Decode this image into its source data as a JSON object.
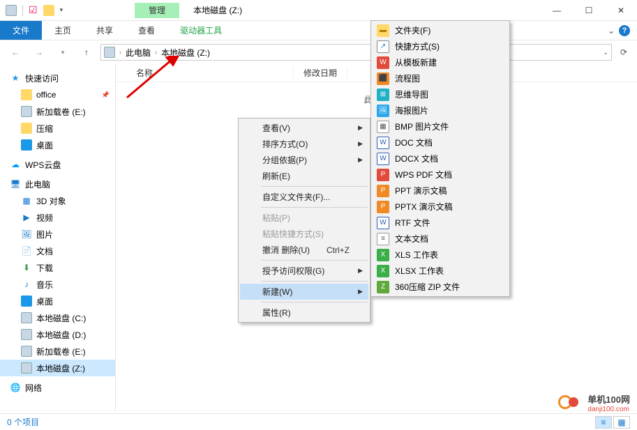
{
  "title": "本地磁盘 (Z:)",
  "ribbon_ctx_group": "管理",
  "tabs": {
    "file": "文件",
    "home": "主页",
    "share": "共享",
    "view": "查看",
    "drive_tools": "驱动器工具"
  },
  "breadcrumb": {
    "root": "此电脑",
    "current": "本地磁盘 (Z:)"
  },
  "columns": {
    "name": "名称",
    "date": "修改日期"
  },
  "empty_folder_msg": "此文件",
  "nav": {
    "quick_access": "快速访问",
    "office": "office",
    "new_volume_e": "新加载卷 (E:)",
    "compressed": "压缩",
    "desktop": "桌面",
    "wps": "WPS云盘",
    "this_pc": "此电脑",
    "objects_3d": "3D 对象",
    "videos": "视频",
    "pictures": "图片",
    "documents": "文档",
    "downloads": "下载",
    "music": "音乐",
    "desktop2": "桌面",
    "drive_c": "本地磁盘 (C:)",
    "drive_d": "本地磁盘 (D:)",
    "new_volume_e2": "新加载卷 (E:)",
    "drive_z": "本地磁盘 (Z:)",
    "network": "网络"
  },
  "ctx": {
    "view": "查看(V)",
    "sort": "排序方式(O)",
    "group": "分组依据(P)",
    "refresh": "刷新(E)",
    "custom_folder": "自定义文件夹(F)...",
    "paste": "粘贴(P)",
    "paste_shortcut": "粘贴快捷方式(S)",
    "undo": "撤消 删除(U)",
    "undo_sc": "Ctrl+Z",
    "grant_access": "授予访问权限(G)",
    "new": "新建(W)",
    "properties": "属性(R)"
  },
  "submenu": {
    "folder": "文件夹(F)",
    "shortcut": "快捷方式(S)",
    "from_template": "从模板新建",
    "flowchart": "流程图",
    "mindmap": "思维导图",
    "poster": "海报图片",
    "bmp": "BMP 图片文件",
    "doc": "DOC 文档",
    "docx": "DOCX 文档",
    "wps_pdf": "WPS PDF 文档",
    "ppt": "PPT 演示文稿",
    "pptx": "PPTX 演示文稿",
    "rtf": "RTF 文件",
    "txt": "文本文档",
    "xls": "XLS 工作表",
    "xlsx": "XLSX 工作表",
    "zip": "360压缩 ZIP 文件"
  },
  "status": {
    "items": "0 个项目"
  },
  "watermark": {
    "line1": "单机100网",
    "line2": "danji100.com"
  }
}
